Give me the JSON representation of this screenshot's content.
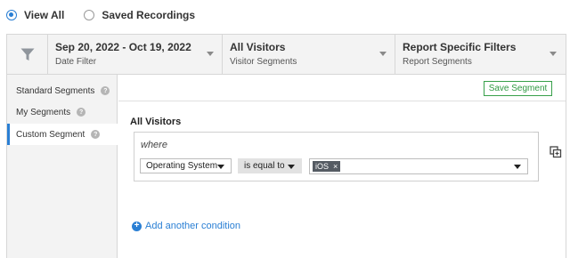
{
  "view_options": [
    {
      "label": "View All",
      "checked": true
    },
    {
      "label": "Saved Recordings",
      "checked": false
    }
  ],
  "filters": {
    "date": {
      "title": "Sep 20, 2022 - Oct 19, 2022",
      "subtitle": "Date Filter"
    },
    "visitor": {
      "title": "All Visitors",
      "subtitle": "Visitor Segments"
    },
    "report": {
      "title": "Report Specific Filters",
      "subtitle": "Report Segments"
    }
  },
  "sidebar": {
    "items": [
      {
        "label": "Standard Segments",
        "active": false
      },
      {
        "label": "My Segments",
        "active": false
      },
      {
        "label": "Custom Segment",
        "active": true
      }
    ],
    "help_glyph": "?"
  },
  "main": {
    "save_label": "Save Segment",
    "segment_title": "All Visitors",
    "where_label": "where",
    "condition": {
      "field": "Operating System",
      "operator": "is equal to",
      "values": [
        "iOS"
      ]
    },
    "add_condition_label": "Add another condition"
  },
  "colors": {
    "accent": "#2a7fd4",
    "save_green": "#2f9a42",
    "tag_bg": "#555b63"
  }
}
